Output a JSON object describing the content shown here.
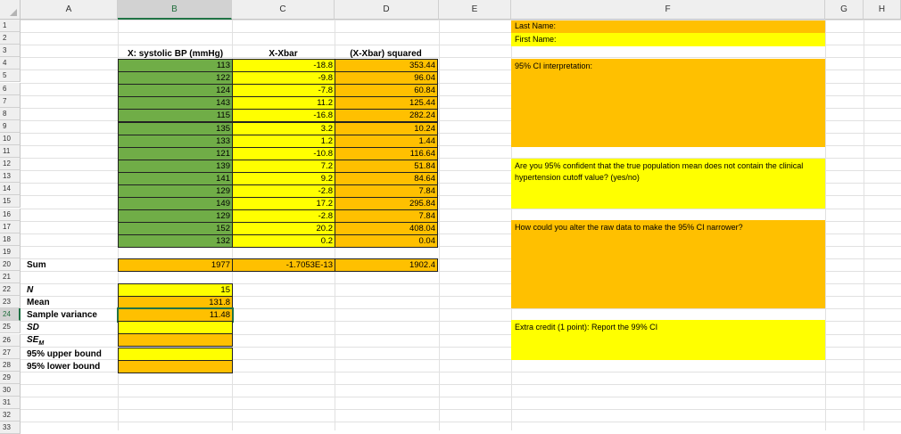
{
  "columns": [
    "A",
    "B",
    "C",
    "D",
    "E",
    "F",
    "G",
    "H"
  ],
  "selected_column": "B",
  "rows": [
    "1",
    "2",
    "3",
    "4",
    "5",
    "6",
    "7",
    "8",
    "9",
    "10",
    "11",
    "12",
    "13",
    "14",
    "15",
    "16",
    "17",
    "18",
    "19",
    "20",
    "21",
    "22",
    "23",
    "24",
    "25",
    "26",
    "27",
    "28",
    "29",
    "30",
    "31",
    "32",
    "33"
  ],
  "selected_row": "24",
  "headers": {
    "b": "X: systolic BP (mmHg)",
    "c": "X-Xbar",
    "d": "(X-Xbar) squared"
  },
  "x_values": [
    "113",
    "122",
    "124",
    "143",
    "115",
    "135",
    "133",
    "121",
    "139",
    "141",
    "129",
    "149",
    "129",
    "152",
    "132"
  ],
  "x_minus_mean": [
    "-18.8",
    "-9.8",
    "-7.8",
    "11.2",
    "-16.8",
    "3.2",
    "1.2",
    "-10.8",
    "7.2",
    "9.2",
    "-2.8",
    "17.2",
    "-2.8",
    "20.2",
    "0.2"
  ],
  "squared": [
    "353.44",
    "96.04",
    "60.84",
    "125.44",
    "282.24",
    "10.24",
    "1.44",
    "116.64",
    "51.84",
    "84.64",
    "7.84",
    "295.84",
    "7.84",
    "408.04",
    "0.04"
  ],
  "sum_row": {
    "label": "Sum",
    "b": "1977",
    "c": "-1.7053E-13",
    "d": "1902.4"
  },
  "stats": {
    "n_label": "N",
    "n_value": "15",
    "mean_label": "Mean",
    "mean_value": "131.8",
    "variance_label": "Sample variance",
    "variance_value": "11.48",
    "sd_label": "SD",
    "se_label": "SE",
    "se_sub": "M",
    "upper_label": "95% upper bound",
    "lower_label": "95% lower bound"
  },
  "questions": {
    "last_name": "Last Name:",
    "first_name": "First Name:",
    "ci_interp": "95% CI interpretation:",
    "confident": "Are you 95% confident that the true population mean does not contain the clinical hypertension cutoff value? (yes/no)",
    "narrower": "How could you alter the raw data to make the 95% CI narrower?",
    "extra_credit": "Extra credit (1 point): Report the 99% CI"
  },
  "colors": {
    "green": "#70ad47",
    "yellow": "#ffff00",
    "orange": "#ffc000",
    "excel_green": "#217346"
  }
}
